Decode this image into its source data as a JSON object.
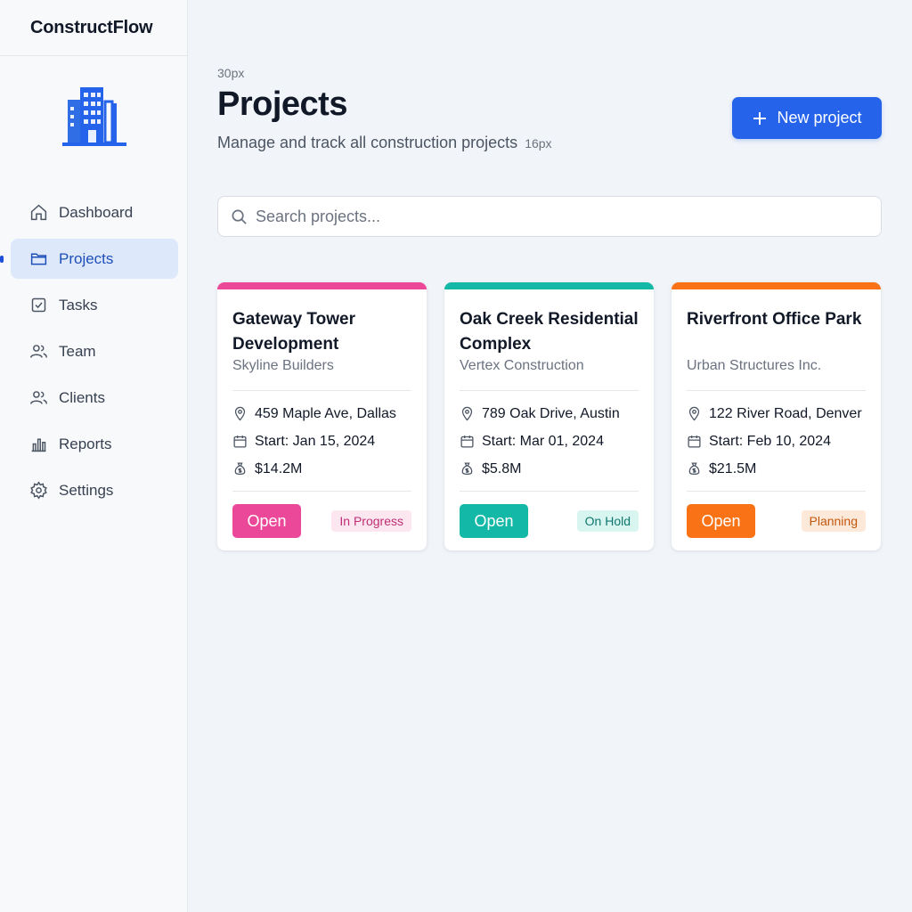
{
  "app": {
    "name": "ConstructFlow",
    "logo_icon": "building-icon",
    "accent": "#2563eb"
  },
  "sidebar": {
    "items": [
      {
        "label": "Dashboard",
        "icon": "home-icon",
        "active": false
      },
      {
        "label": "Projects",
        "icon": "folder-icon",
        "active": true
      },
      {
        "label": "Tasks",
        "icon": "checkbox-icon",
        "active": false
      },
      {
        "label": "Team",
        "icon": "users-icon",
        "active": false
      },
      {
        "label": "Clients",
        "icon": "users-icon",
        "active": false
      },
      {
        "label": "Reports",
        "icon": "bar-chart-icon",
        "active": false
      },
      {
        "label": "Settings",
        "icon": "gear-icon",
        "active": false
      }
    ]
  },
  "header": {
    "annotation_title": "30px",
    "title": "Projects",
    "subtitle": "Manage and track all construction projects",
    "annotation_subtitle": "16px",
    "new_button": "New project"
  },
  "search": {
    "placeholder": "Search projects..."
  },
  "projects": [
    {
      "title": "Gateway Tower Development",
      "company": "Skyline Builders",
      "address": "459 Maple Ave, Dallas",
      "start": "Start: Jan 15, 2024",
      "budget": "$14.2M",
      "open_label": "Open",
      "status": "In Progress",
      "color": "#ec4899",
      "badge_bg": "#fce7f1",
      "badge_color": "#be2f73"
    },
    {
      "title": "Oak Creek Residential Complex",
      "company": "Vertex Construction",
      "address": "789 Oak Drive, Austin",
      "start": "Start: Mar 01, 2024",
      "budget": "$5.8M",
      "open_label": "Open",
      "status": "On Hold",
      "color": "#14b8a6",
      "badge_bg": "#d8f5f0",
      "badge_color": "#0f766e"
    },
    {
      "title": "Riverfront Office Park",
      "company": "Urban Structures Inc.",
      "address": "122 River Road, Denver",
      "start": "Start: Feb 10, 2024",
      "budget": "$21.5M",
      "open_label": "Open",
      "status": "Planning",
      "color": "#f97316",
      "badge_bg": "#fde9da",
      "badge_color": "#c2570c"
    }
  ]
}
